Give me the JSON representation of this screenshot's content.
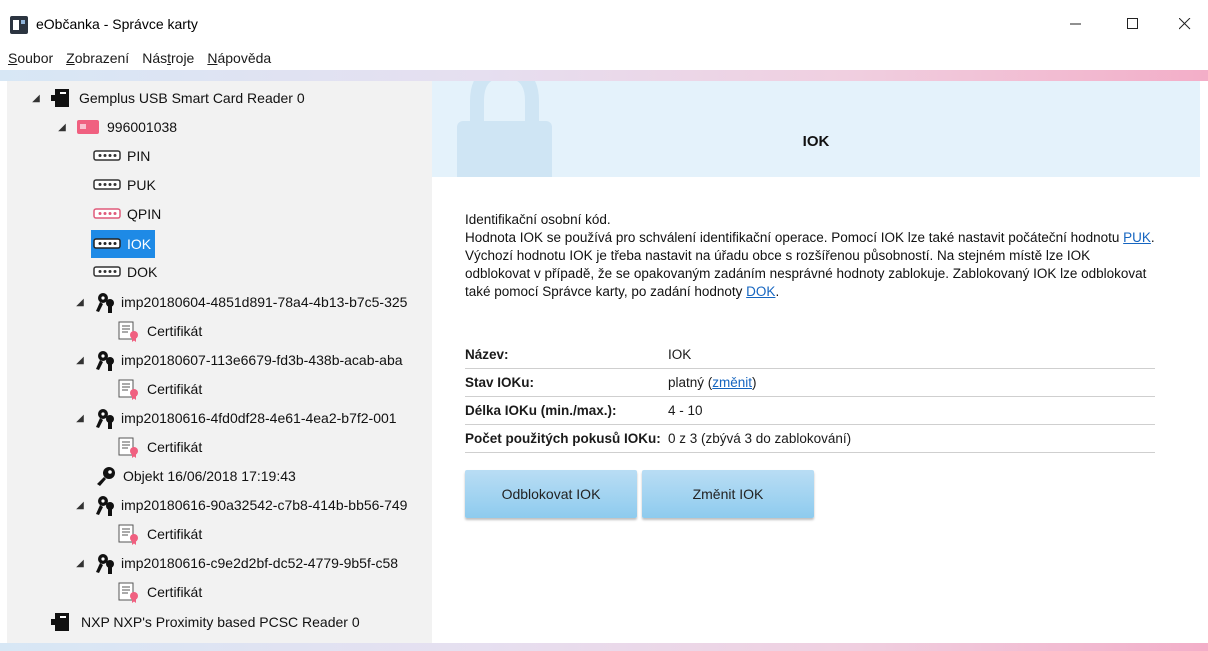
{
  "window": {
    "title": "eObčanka - Správce karty"
  },
  "menu": {
    "items": [
      {
        "pre": "",
        "u": "S",
        "post": "oubor"
      },
      {
        "pre": "",
        "u": "Z",
        "post": "obrazení"
      },
      {
        "pre": "Nás",
        "u": "t",
        "post": "roje"
      },
      {
        "pre": "",
        "u": "N",
        "post": "ápověda"
      }
    ]
  },
  "tree": {
    "reader1": "Gemplus USB Smart Card Reader 0",
    "card": "996001038",
    "pin": "PIN",
    "puk": "PUK",
    "qpin": "QPIN",
    "iok": "IOK",
    "dok": "DOK",
    "key1": "imp20180604-4851d891-78a4-4b13-b7c5-325",
    "key2": "imp20180607-113e6679-fd3b-438b-acab-aba",
    "key3": "imp20180616-4fd0df28-4e61-4ea2-b7f2-001",
    "object": "Objekt 16/06/2018 17:19:43",
    "key4": "imp20180616-90a32542-c7b8-414b-bb56-749",
    "key5": "imp20180616-c9e2d2bf-dc52-4779-9b5f-c58",
    "cert": "Certifikát",
    "reader2": "NXP NXP's Proximity based PCSC Reader 0"
  },
  "detail": {
    "title": "IOK",
    "line1": "Identifikační osobní kód.",
    "line2a": "Hodnota IOK se používá pro schválení identifikační operace. Pomocí IOK lze také nastavit počáteční hodnotu ",
    "line2link": "PUK",
    "line2b": ".",
    "line3a": "Výchozí hodnotu IOK je třeba nastavit na úřadu obce s rozšířenou působností. Na stejném místě lze IOK odblokovat v případě, že se opakovaným zadáním nesprávné hodnoty zablokuje. Zablokovaný IOK lze odblokovat také pomocí Správce karty, po zadání hodnoty ",
    "line3link": "DOK",
    "line3b": ".",
    "props": {
      "name_label": "Název:",
      "name_value": "IOK",
      "state_label": "Stav IOKu:",
      "state_value": "platný (",
      "state_link": "změnit",
      "state_close": ")",
      "length_label": "Délka IOKu (min./max.):",
      "length_value": "4 - 10",
      "attempts_label": "Počet použitých pokusů IOKu:",
      "attempts_value": "0 z 3 (zbývá 3 do zablokování)"
    },
    "buttons": {
      "unblock": "Odblokovat IOK",
      "change": "Změnit IOK"
    }
  },
  "colors": {
    "selection": "#1e8ae6",
    "accent_link": "#1565c0",
    "button": "#a6d4f1",
    "qpin_icon": "#e05a7a",
    "card_icon": "#f06080"
  }
}
